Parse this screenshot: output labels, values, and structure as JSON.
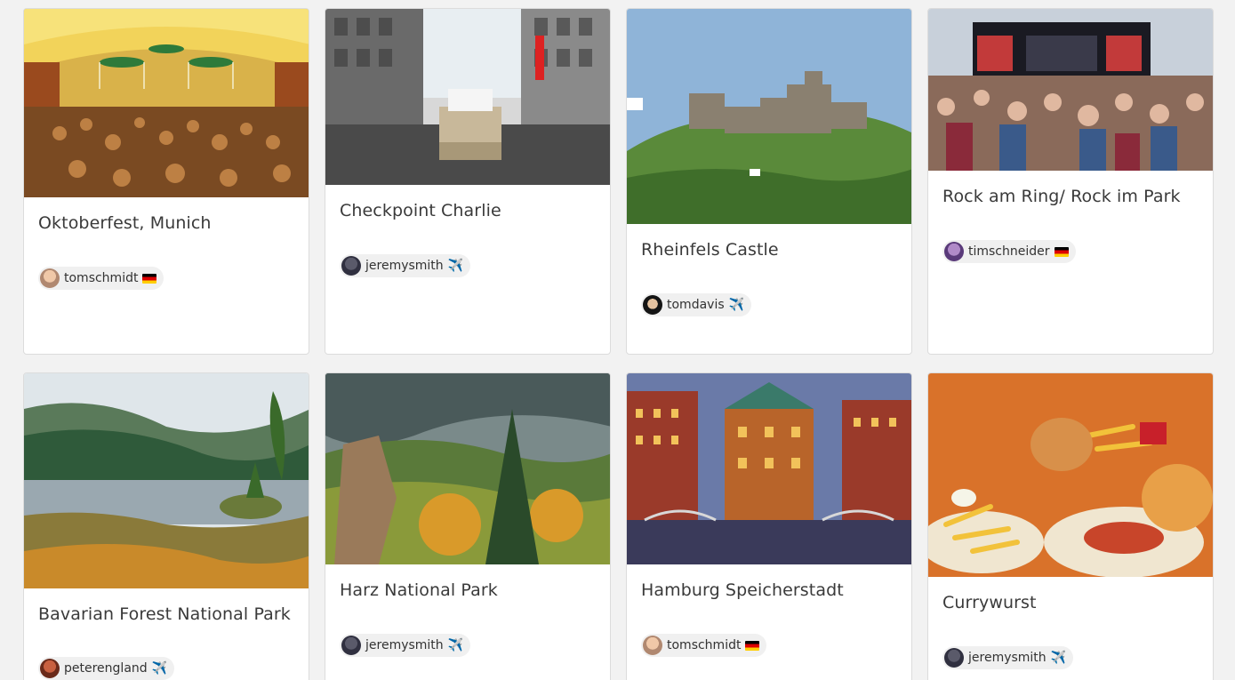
{
  "cards": [
    {
      "title": "Oktoberfest, Munich",
      "author": "tomschmidt",
      "badge": "de-flag",
      "image": "beer-hall-photo"
    },
    {
      "title": "Checkpoint Charlie",
      "author": "jeremysmith",
      "badge": "airplane",
      "image": "street-checkpoint-photo"
    },
    {
      "title": "Rheinfels Castle",
      "author": "tomdavis",
      "badge": "airplane",
      "image": "castle-hill-photo"
    },
    {
      "title": "Rock am Ring/ Rock im Park",
      "author": "timschneider",
      "badge": "de-flag",
      "image": "concert-crowd-photo"
    },
    {
      "title": "Bavarian Forest National Park",
      "author": "peterengland",
      "badge": "airplane",
      "image": "forest-lake-photo"
    },
    {
      "title": "Harz National Park",
      "author": "jeremysmith",
      "badge": "airplane",
      "image": "autumn-forest-photo"
    },
    {
      "title": "Hamburg Speicherstadt",
      "author": "tomschmidt",
      "badge": "de-flag",
      "image": "warehouse-district-photo"
    },
    {
      "title": "Currywurst",
      "author": "jeremysmith",
      "badge": "airplane",
      "image": "currywurst-fries-photo"
    }
  ],
  "colors": {
    "background": "#f2f2f2",
    "card": "#ffffff",
    "chip": "#f0f0f0",
    "title_text": "#3a3a3a"
  },
  "badges": {
    "airplane": "✈️"
  }
}
